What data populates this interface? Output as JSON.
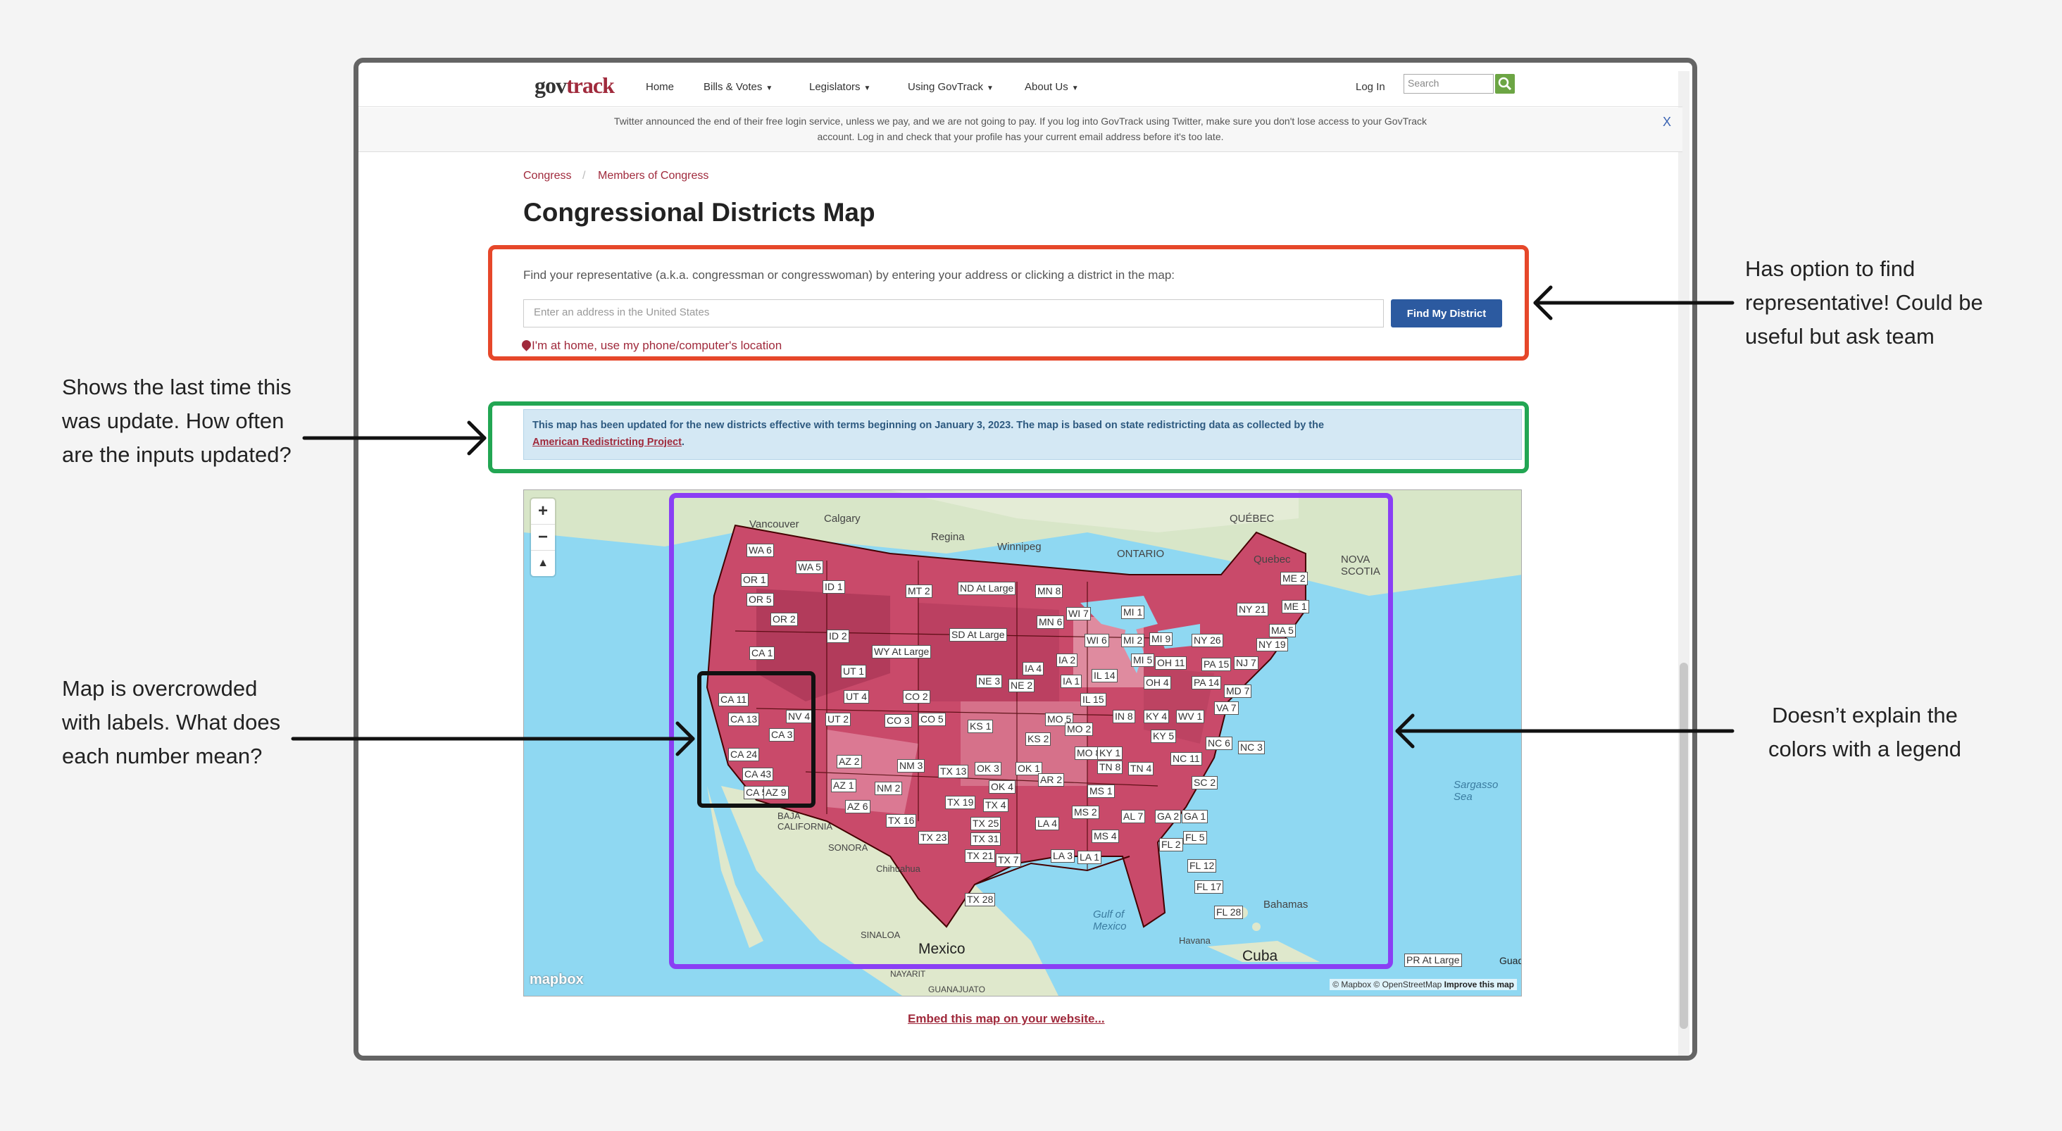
{
  "nav": {
    "logo_gov": "gov",
    "logo_track": "track",
    "items": [
      {
        "label": "Home"
      },
      {
        "label": "Bills & Votes"
      },
      {
        "label": "Legislators"
      },
      {
        "label": "Using GovTrack"
      },
      {
        "label": "About Us"
      }
    ],
    "login": "Log In",
    "search_placeholder": "Search",
    "search_icon": "search-icon"
  },
  "banner": {
    "text": "Twitter announced the end of their free login service, unless we pay, and we are not going to pay. If you log into GovTrack using Twitter, make sure you don't lose access to your GovTrack account. Log in and check that your profile has your current email address before it's too late.",
    "close": "X"
  },
  "breadcrumb": [
    "Congress",
    "Members of Congress"
  ],
  "breadcrumb_sep": "/",
  "page_title": "Congressional Districts Map",
  "finder": {
    "prompt": "Find your representative (a.k.a. congressman or congresswoman) by entering your address or clicking a district in the map:",
    "input_placeholder": "Enter an address in the United States",
    "button": "Find My District",
    "home_link": "I'm at home, use my phone/computer's location"
  },
  "update_notice": {
    "text": "This map has been updated for the new districts effective with terms beginning on January 3, 2023. The map is based on state redistricting data as collected by the",
    "link": "American Redistricting Project",
    "suffix": "."
  },
  "map": {
    "zoom_in": "+",
    "zoom_out": "−",
    "compass": "▲",
    "place_labels": {
      "calgary": "Calgary",
      "vancouver": "Vancouver",
      "regina": "Regina",
      "winnipeg": "Winnipeg",
      "ontario": "ONTARIO",
      "quebec_prov": "QUÉBEC",
      "quebec": "Quebec",
      "nova_scotia": "NOVA SCOTIA",
      "mexico": "Mexico",
      "cuba": "Cuba",
      "bahamas": "Bahamas",
      "havana": "Havana",
      "chihuahua": "Chihuahua",
      "sonora": "SONORA",
      "sinaloa": "SINALOA",
      "gulf": "Gulf of Mexico",
      "sargasso": "Sargasso Sea",
      "baja": "BAJA CALIFORNIA",
      "guanajuato": "GUANAJUATO",
      "nayarit": "NAYARIT"
    },
    "districts": [
      "WA 6",
      "WA 5",
      "OR 1",
      "OR 5",
      "OR 2",
      "ID 1",
      "ID 2",
      "MT 2",
      "ND At Large",
      "MN 8",
      "MN 6",
      "WI 7",
      "MI 1",
      "ME 2",
      "ME 1",
      "NY 21",
      "MA 5",
      "NY 19",
      "NY 26",
      "PA 15",
      "NJ 7",
      "MD 7",
      "VA 7",
      "NC 3",
      "NC 6",
      "NC 11",
      "SC 2",
      "GA 1",
      "GA 2",
      "FL 5",
      "FL 2",
      "FL 12",
      "FL 17",
      "FL 28",
      "CA 1",
      "CA 11",
      "CA 13",
      "CA 3",
      "CA 24",
      "CA 43",
      "CA 51",
      "NV 4",
      "AZ 1",
      "AZ 2",
      "AZ 6",
      "AZ 9",
      "UT 1",
      "UT 4",
      "UT 2",
      "WY At Large",
      "SD At Large",
      "CO 2",
      "CO 3",
      "CO 5",
      "NE 3",
      "NE 2",
      "KS 1",
      "KS 2",
      "IA 4",
      "IA 2",
      "IA 1",
      "IL 14",
      "IL 15",
      "IN 8",
      "KY 4",
      "KY 5",
      "WV 1",
      "WI 6",
      "MI 2",
      "MI 9",
      "MI 5",
      "OH 11",
      "OH 4",
      "PA 14",
      "MO 5",
      "MO 2",
      "MO 8",
      "OK 3",
      "OK 1",
      "OK 4",
      "NM 3",
      "NM 2",
      "TX 13",
      "TX 19",
      "TX 16",
      "TX 23",
      "TX 4",
      "TX 25",
      "TX 31",
      "TX 21",
      "TX 7",
      "TX 28",
      "AR 2",
      "LA 4",
      "LA 3",
      "LA 1",
      "MS 1",
      "MS 2",
      "MS 4",
      "AL 7",
      "TN 8",
      "TN 4",
      "KY 1"
    ],
    "logo": "mapbox",
    "attribution": "© Mapbox © OpenStreetMap",
    "improve": "Improve this map",
    "extra_labels": [
      "PR At Large",
      "Guad"
    ]
  },
  "embed_link": "Embed this map on your website...",
  "annotations": {
    "right_top": "Has option to find representative! Could be useful but ask team",
    "left_top": "Shows the last time this was update. How often are the inputs updated?",
    "left_bottom": "Map is overcrowded with labels. What does each number mean?",
    "right_bottom": "Doesn’t explain the colors with a legend"
  },
  "colors": {
    "red_box": "#e6472a",
    "green_box": "#22a653",
    "purple_box": "#8a3ff4",
    "district_fill": "#c94a6a",
    "brand": "#a02a3c"
  }
}
